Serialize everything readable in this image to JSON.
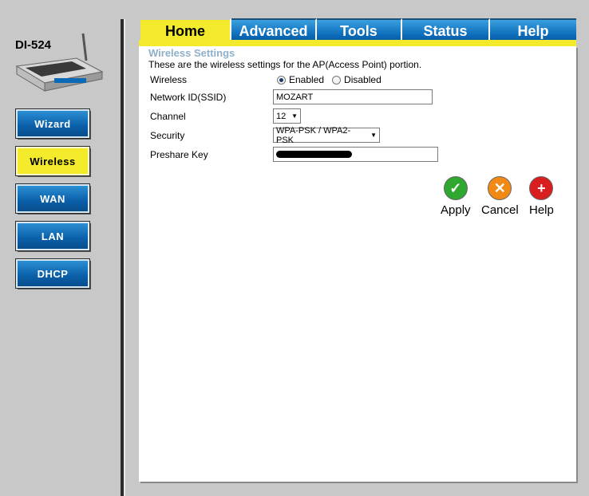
{
  "device": {
    "model": "DI-524"
  },
  "tabs": [
    {
      "label": "Home",
      "active": true
    },
    {
      "label": "Advanced",
      "active": false
    },
    {
      "label": "Tools",
      "active": false
    },
    {
      "label": "Status",
      "active": false
    },
    {
      "label": "Help",
      "active": false
    }
  ],
  "sidebar": {
    "items": [
      {
        "label": "Wizard",
        "active": false
      },
      {
        "label": "Wireless",
        "active": true
      },
      {
        "label": "WAN",
        "active": false
      },
      {
        "label": "LAN",
        "active": false
      },
      {
        "label": "DHCP",
        "active": false
      }
    ]
  },
  "wireless": {
    "title": "Wireless Settings",
    "description": "These are the wireless settings for the AP(Access Point) portion.",
    "labels": {
      "wireless": "Wireless",
      "ssid": "Network ID(SSID)",
      "channel": "Channel",
      "security": "Security",
      "preshare": "Preshare Key"
    },
    "radio": {
      "enabled": "Enabled",
      "disabled": "Disabled",
      "selected": "enabled"
    },
    "ssid_value": "MOZART",
    "channel_value": "12",
    "security_value": "WPA-PSK / WPA2-PSK"
  },
  "actions": {
    "apply": "Apply",
    "cancel": "Cancel",
    "help": "Help"
  },
  "colors": {
    "tab_blue": "#0b6ab8",
    "highlight_yellow": "#f2ea2a",
    "title_gray_blue": "#8fb0c8"
  }
}
